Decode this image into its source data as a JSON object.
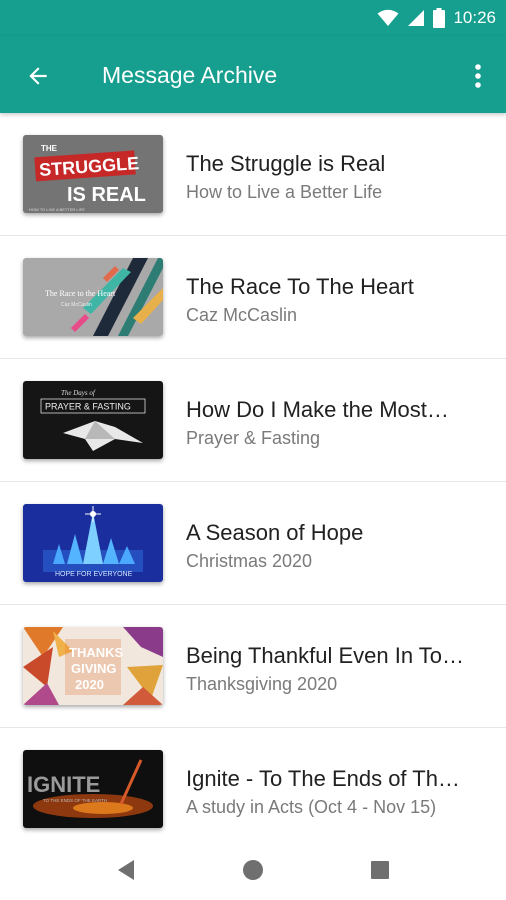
{
  "status_bar": {
    "time": "10:26"
  },
  "app_bar": {
    "title": "Message Archive",
    "back_icon": "arrow-back-icon",
    "menu_icon": "more-vert-icon"
  },
  "colors": {
    "primary": "#169e8e",
    "title_text": "#212121",
    "subtitle_text": "#7a7a7a"
  },
  "messages": [
    {
      "title": "The Struggle is Real",
      "subtitle": "How to Live a Better Life",
      "thumb_text": [
        "THE",
        "STRUGGLE",
        "IS REAL",
        "HOW TO LIVE A BETTER LIFE"
      ]
    },
    {
      "title": "The Race To The Heart",
      "subtitle": "Caz McCaslin",
      "thumb_text": [
        "The Race to the Heart",
        "Caz McCaslin"
      ]
    },
    {
      "title": "How Do I Make the Most…",
      "subtitle": "Prayer & Fasting",
      "thumb_text": [
        "The Days of",
        "PRAYER & FASTING"
      ]
    },
    {
      "title": "A Season of Hope",
      "subtitle": "Christmas 2020",
      "thumb_text": [
        "HOPE FOR EVERYONE"
      ]
    },
    {
      "title": "Being Thankful Even In To…",
      "subtitle": "Thanksgiving 2020",
      "thumb_text": [
        "THANKS",
        "GIVING",
        "2020"
      ]
    },
    {
      "title": "Ignite - To The Ends of Th…",
      "subtitle": "A study in Acts (Oct 4 - Nov 15)",
      "thumb_text": [
        "IGNITE",
        "TO THE ENDS OF THE EARTH"
      ]
    }
  ]
}
